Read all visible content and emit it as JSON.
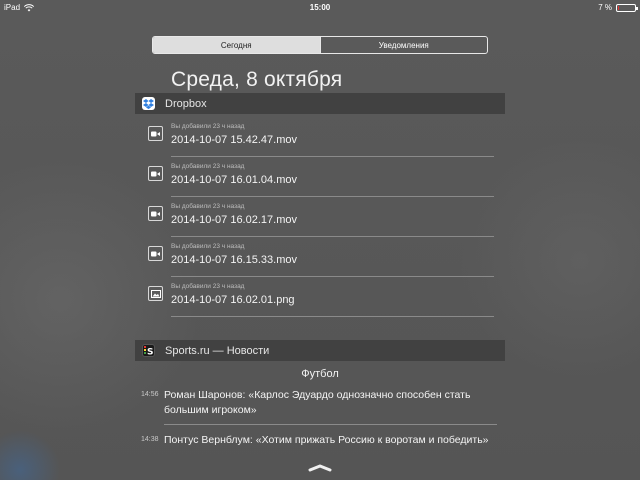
{
  "status_bar": {
    "device": "iPad",
    "time": "15:00",
    "battery": "7 %",
    "battery_level": 0.07
  },
  "segmented": {
    "today": "Сегодня",
    "notifications": "Уведомления"
  },
  "date_title": "Среда, 8 октября",
  "dropbox": {
    "title": "Dropbox",
    "files": [
      {
        "meta": "Вы добавили 23 ч назад",
        "name": "2014-10-07 15.42.47.mov",
        "icon": "video-icon"
      },
      {
        "meta": "Вы добавили 23 ч назад",
        "name": "2014-10-07 16.01.04.mov",
        "icon": "video-icon"
      },
      {
        "meta": "Вы добавили 23 ч назад",
        "name": "2014-10-07 16.02.17.mov",
        "icon": "video-icon"
      },
      {
        "meta": "Вы добавили 23 ч назад",
        "name": "2014-10-07 16.15.33.mov",
        "icon": "video-icon"
      },
      {
        "meta": "Вы добавили 23 ч назад",
        "name": "2014-10-07 16.02.01.png",
        "icon": "image-icon"
      }
    ]
  },
  "sports": {
    "title": "Sports.ru — Новости",
    "category": "Футбол",
    "news": [
      {
        "time": "14:56",
        "headline": "Роман Шаронов: «Карлос Эдуардо однозначно способен стать большим игроком»"
      },
      {
        "time": "14:38",
        "headline": "Понтус Вернблум: «Хотим прижать Россию к воротам и победить»"
      }
    ]
  },
  "colors": {
    "background": "#5b5b5b",
    "header": "#414141",
    "dropbox_blue": "#2f7fe0",
    "battery_red": "#e33333"
  }
}
